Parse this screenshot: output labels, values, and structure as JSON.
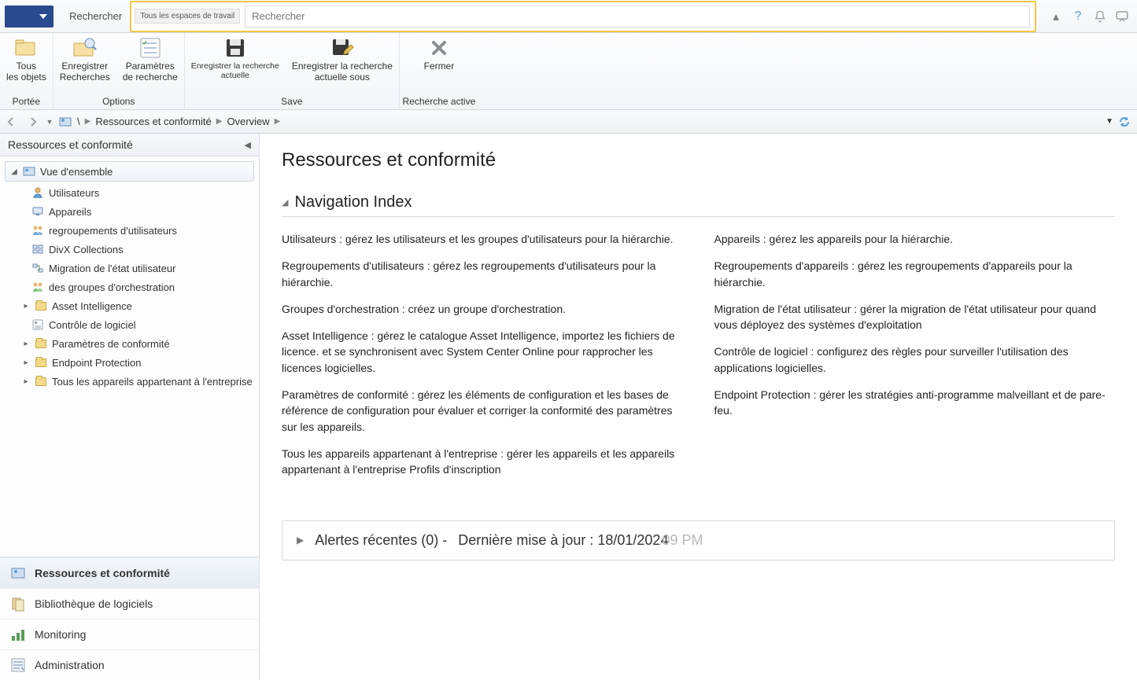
{
  "top": {
    "tab_search": "Rechercher",
    "scope_label": "Tous les espaces de travail",
    "search_placeholder": "Rechercher"
  },
  "ribbon": {
    "scope": {
      "all_objects": "Tous\nles objets",
      "group": "Portée"
    },
    "options": {
      "save_searches": "Enregistrer\nRecherches",
      "search_settings": "Paramètres\nde recherche",
      "group": "Options"
    },
    "save": {
      "save_current_small": "Enregistrer la recherche\nactuelle",
      "save_current_as": "Enregistrer la recherche\nactuelle sous",
      "group": "Save"
    },
    "active": {
      "close": "Fermer",
      "group": "Recherche active"
    }
  },
  "crumbs": {
    "workspace": "Ressources et conformité",
    "page": "Overview"
  },
  "sidebar": {
    "title": "Ressources et conformité",
    "root": "Vue d'ensemble",
    "items": [
      "Utilisateurs",
      "Appareils",
      "regroupements d'utilisateurs",
      "DivX Collections",
      "Migration de l'état utilisateur",
      "des groupes d'orchestration",
      "Asset Intelligence",
      "Contrôle de logiciel",
      "Paramètres de conformité",
      "Endpoint Protection",
      "Tous les appareils appartenant à l'entreprise"
    ],
    "expandable": [
      false,
      false,
      false,
      false,
      false,
      false,
      true,
      false,
      true,
      true,
      true
    ]
  },
  "wunderbar": {
    "items": [
      "Ressources et conformité",
      "Bibliothèque de logiciels",
      "Monitoring",
      "Administration"
    ],
    "active_index": 0
  },
  "main": {
    "title": "Ressources et conformité",
    "nav_heading": "Navigation Index",
    "left_entries": [
      "Utilisateurs : gérez les utilisateurs et les groupes d'utilisateurs pour la hiérarchie.",
      "Regroupements d'utilisateurs : gérez les regroupements d'utilisateurs pour la hiérarchie.",
      "Groupes d'orchestration : créez un groupe d'orchestration.",
      "Asset Intelligence : gérez le catalogue Asset Intelligence, importez les fichiers de licence. et se synchronisent avec System Center Online pour rapprocher les licences logicielles.",
      "Paramètres de conformité : gérez les éléments de configuration et les bases de référence de configuration pour évaluer et corriger la conformité des paramètres sur les appareils.",
      "Tous les appareils appartenant à l'entreprise : gérer les appareils et les appareils appartenant à l'entreprise Profils d'inscription"
    ],
    "right_entries": [
      "Appareils : gérez les appareils pour la hiérarchie.",
      "Regroupements d'appareils : gérez les regroupements d'appareils pour la hiérarchie.",
      "Migration de l'état utilisateur : gérer la migration de l'état utilisateur pour quand vous déployez des systèmes d'exploitation",
      "Contrôle de logiciel : configurez des règles pour surveiller l'utilisation des applications logicielles.",
      "Endpoint Protection : gérer les stratégies anti-programme malveillant et de pare-feu."
    ],
    "alerts_label": "Alertes récentes (0) -",
    "alerts_updated": "Dernière mise à jour : 18/01/2024",
    "alerts_time_faded": "09 PM"
  }
}
